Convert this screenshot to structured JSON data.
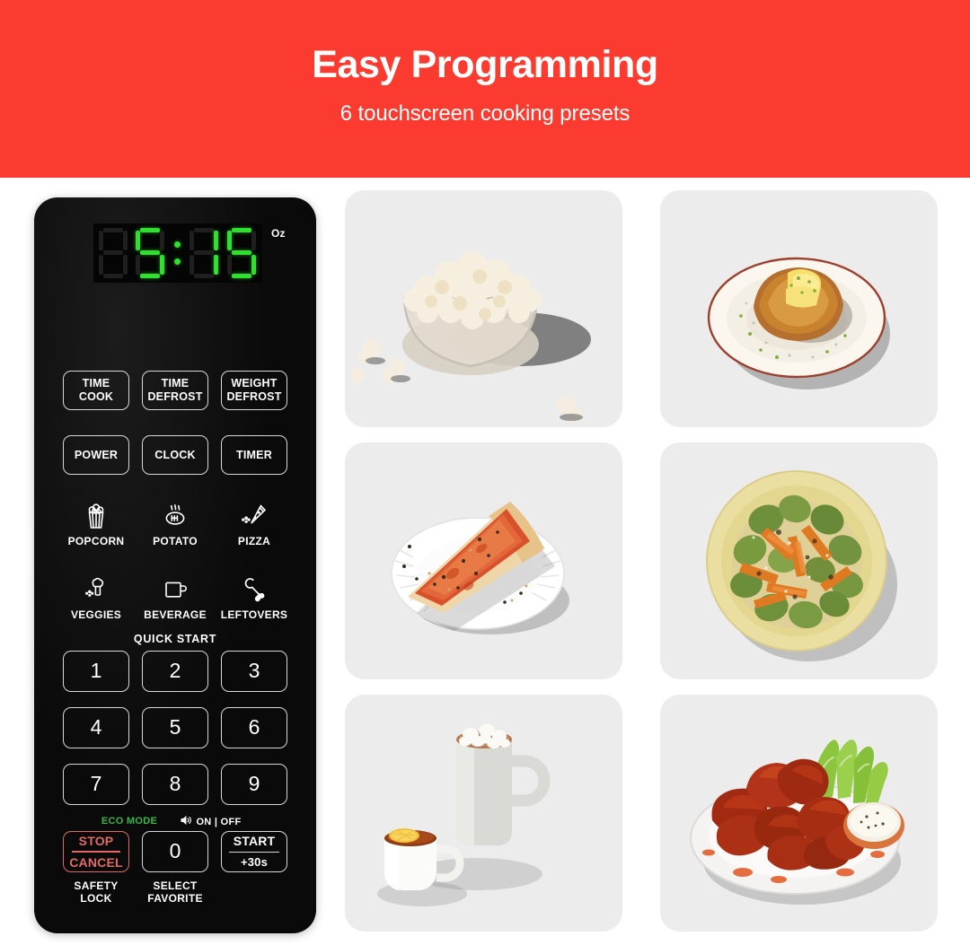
{
  "banner": {
    "title": "Easy Programming",
    "subtitle": "6 touchscreen cooking presets",
    "bg_color": "#fb3b2f",
    "text_color": "#ffffff"
  },
  "control_panel": {
    "body_color": "#0a0a0a",
    "display": {
      "value": "5:15",
      "digits": [
        "",
        "5",
        "1",
        "5"
      ],
      "colon": true,
      "unit_label": "Oz",
      "segment_on_color": "#2fe02f",
      "segment_off_color": "#1f1f1f"
    },
    "function_keys": [
      {
        "line1": "TIME",
        "line2": "COOK"
      },
      {
        "line1": "TIME",
        "line2": "DEFROST"
      },
      {
        "line1": "WEIGHT",
        "line2": "DEFROST"
      },
      {
        "line1": "POWER",
        "line2": ""
      },
      {
        "line1": "CLOCK",
        "line2": ""
      },
      {
        "line1": "TIMER",
        "line2": ""
      }
    ],
    "presets": [
      {
        "label": "POPCORN",
        "icon": "popcorn-icon"
      },
      {
        "label": "POTATO",
        "icon": "potato-icon"
      },
      {
        "label": "PIZZA",
        "icon": "pizza-icon"
      },
      {
        "label": "VEGGIES",
        "icon": "broccoli-icon"
      },
      {
        "label": "BEVERAGE",
        "icon": "mug-icon"
      },
      {
        "label": "LEFTOVERS",
        "icon": "drumstick-icon"
      }
    ],
    "quick_start_label": "QUICK START",
    "number_keys": [
      "1",
      "2",
      "3",
      "4",
      "5",
      "6",
      "7",
      "8",
      "9"
    ],
    "eco_mode_label": "ECO MODE",
    "eco_mode_color": "#39b54a",
    "sound_label": "ON | OFF",
    "sound_icon": "speaker-icon",
    "stop_key": {
      "line1": "STOP",
      "line2": "CANCEL",
      "color": "#e06a66"
    },
    "zero_key": "0",
    "start_key": {
      "line1": "START",
      "line2": "+30s"
    },
    "safety_lock_label": {
      "line1": "SAFETY",
      "line2": "LOCK"
    },
    "select_favorite_label": {
      "line1": "SELECT",
      "line2": "FAVORITE"
    }
  },
  "photo_grid": {
    "tile_bg": "#ececed",
    "tiles": [
      {
        "name": "popcorn-photo",
        "alt": "Bowl of popcorn with scattered kernels"
      },
      {
        "name": "potato-photo",
        "alt": "Baked potato with butter and chives on a plate"
      },
      {
        "name": "pizza-photo",
        "alt": "Cheese pizza slice on a paper plate"
      },
      {
        "name": "veggies-photo",
        "alt": "Roasted brussels sprouts and carrots in a yellow bowl"
      },
      {
        "name": "beverage-photo",
        "alt": "Cup of tea with lemon and mug of hot cocoa with marshmallows"
      },
      {
        "name": "leftovers-photo",
        "alt": "Buffalo wings with celery sticks and ranch dip"
      }
    ]
  }
}
